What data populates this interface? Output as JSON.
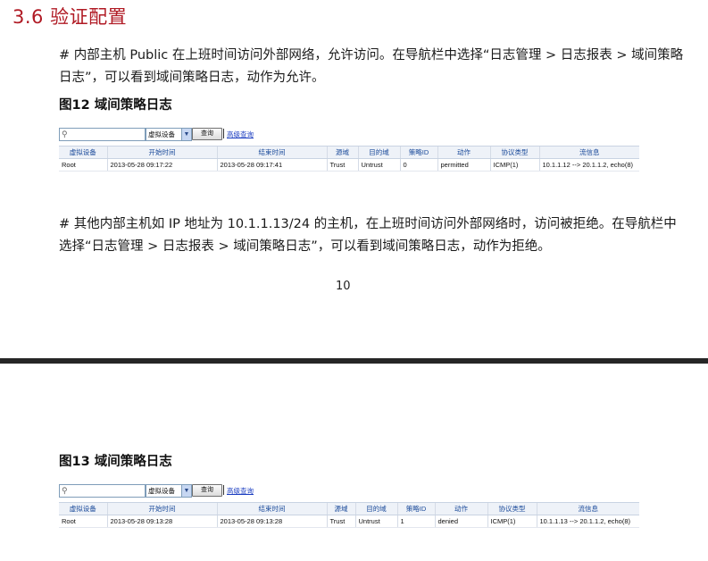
{
  "heading": "3.6  验证配置",
  "para1": "# 内部主机 Public 在上班时间访问外部网络，允许访问。在导航栏中选择“日志管理 > 日志报表 > 域间策略日志”，可以看到域间策略日志，动作为允许。",
  "figure12_caption": "图12  域间策略日志",
  "para2": "# 其他内部主机如 IP 地址为 10.1.1.13/24 的主机，在上班时间访问外部网络时，访问被拒绝。在导航栏中选择“日志管理 > 日志报表 > 域间策略日志”，可以看到域间策略日志，动作为拒绝。",
  "page_number": "10",
  "figure13_caption": "图13  域间策略日志",
  "toolbar": {
    "select_value": "虚拟设备",
    "query_label": "查询",
    "advanced_link": "高级查询"
  },
  "table_headers": [
    "虚拟设备",
    "开始时间",
    "结束时间",
    "源域",
    "目的域",
    "策略ID",
    "动作",
    "协议类型",
    "流信息"
  ],
  "table12_row": {
    "vdev": "Root",
    "start": "2013-05-28 09:17:22",
    "end": "2013-05-28 09:17:41",
    "src": "Trust",
    "dst": "Untrust",
    "policy": "0",
    "action": "permitted",
    "proto": "ICMP(1)",
    "flow": "10.1.1.12 --> 20.1.1.2, echo(8)"
  },
  "table13_row": {
    "vdev": "Root",
    "start": "2013-05-28 09:13:28",
    "end": "2013-05-28 09:13:28",
    "src": "Trust",
    "dst": "Untrust",
    "policy": "1",
    "action": "denied",
    "proto": "ICMP(1)",
    "flow": "10.1.1.13 --> 20.1.1.2, echo(8)"
  },
  "icons": {
    "search": "search-icon",
    "dropdown": "chevron-down-icon"
  },
  "colors": {
    "heading": "#b01a24",
    "header_text": "#1a4a9a",
    "link": "#1a3cc0"
  }
}
